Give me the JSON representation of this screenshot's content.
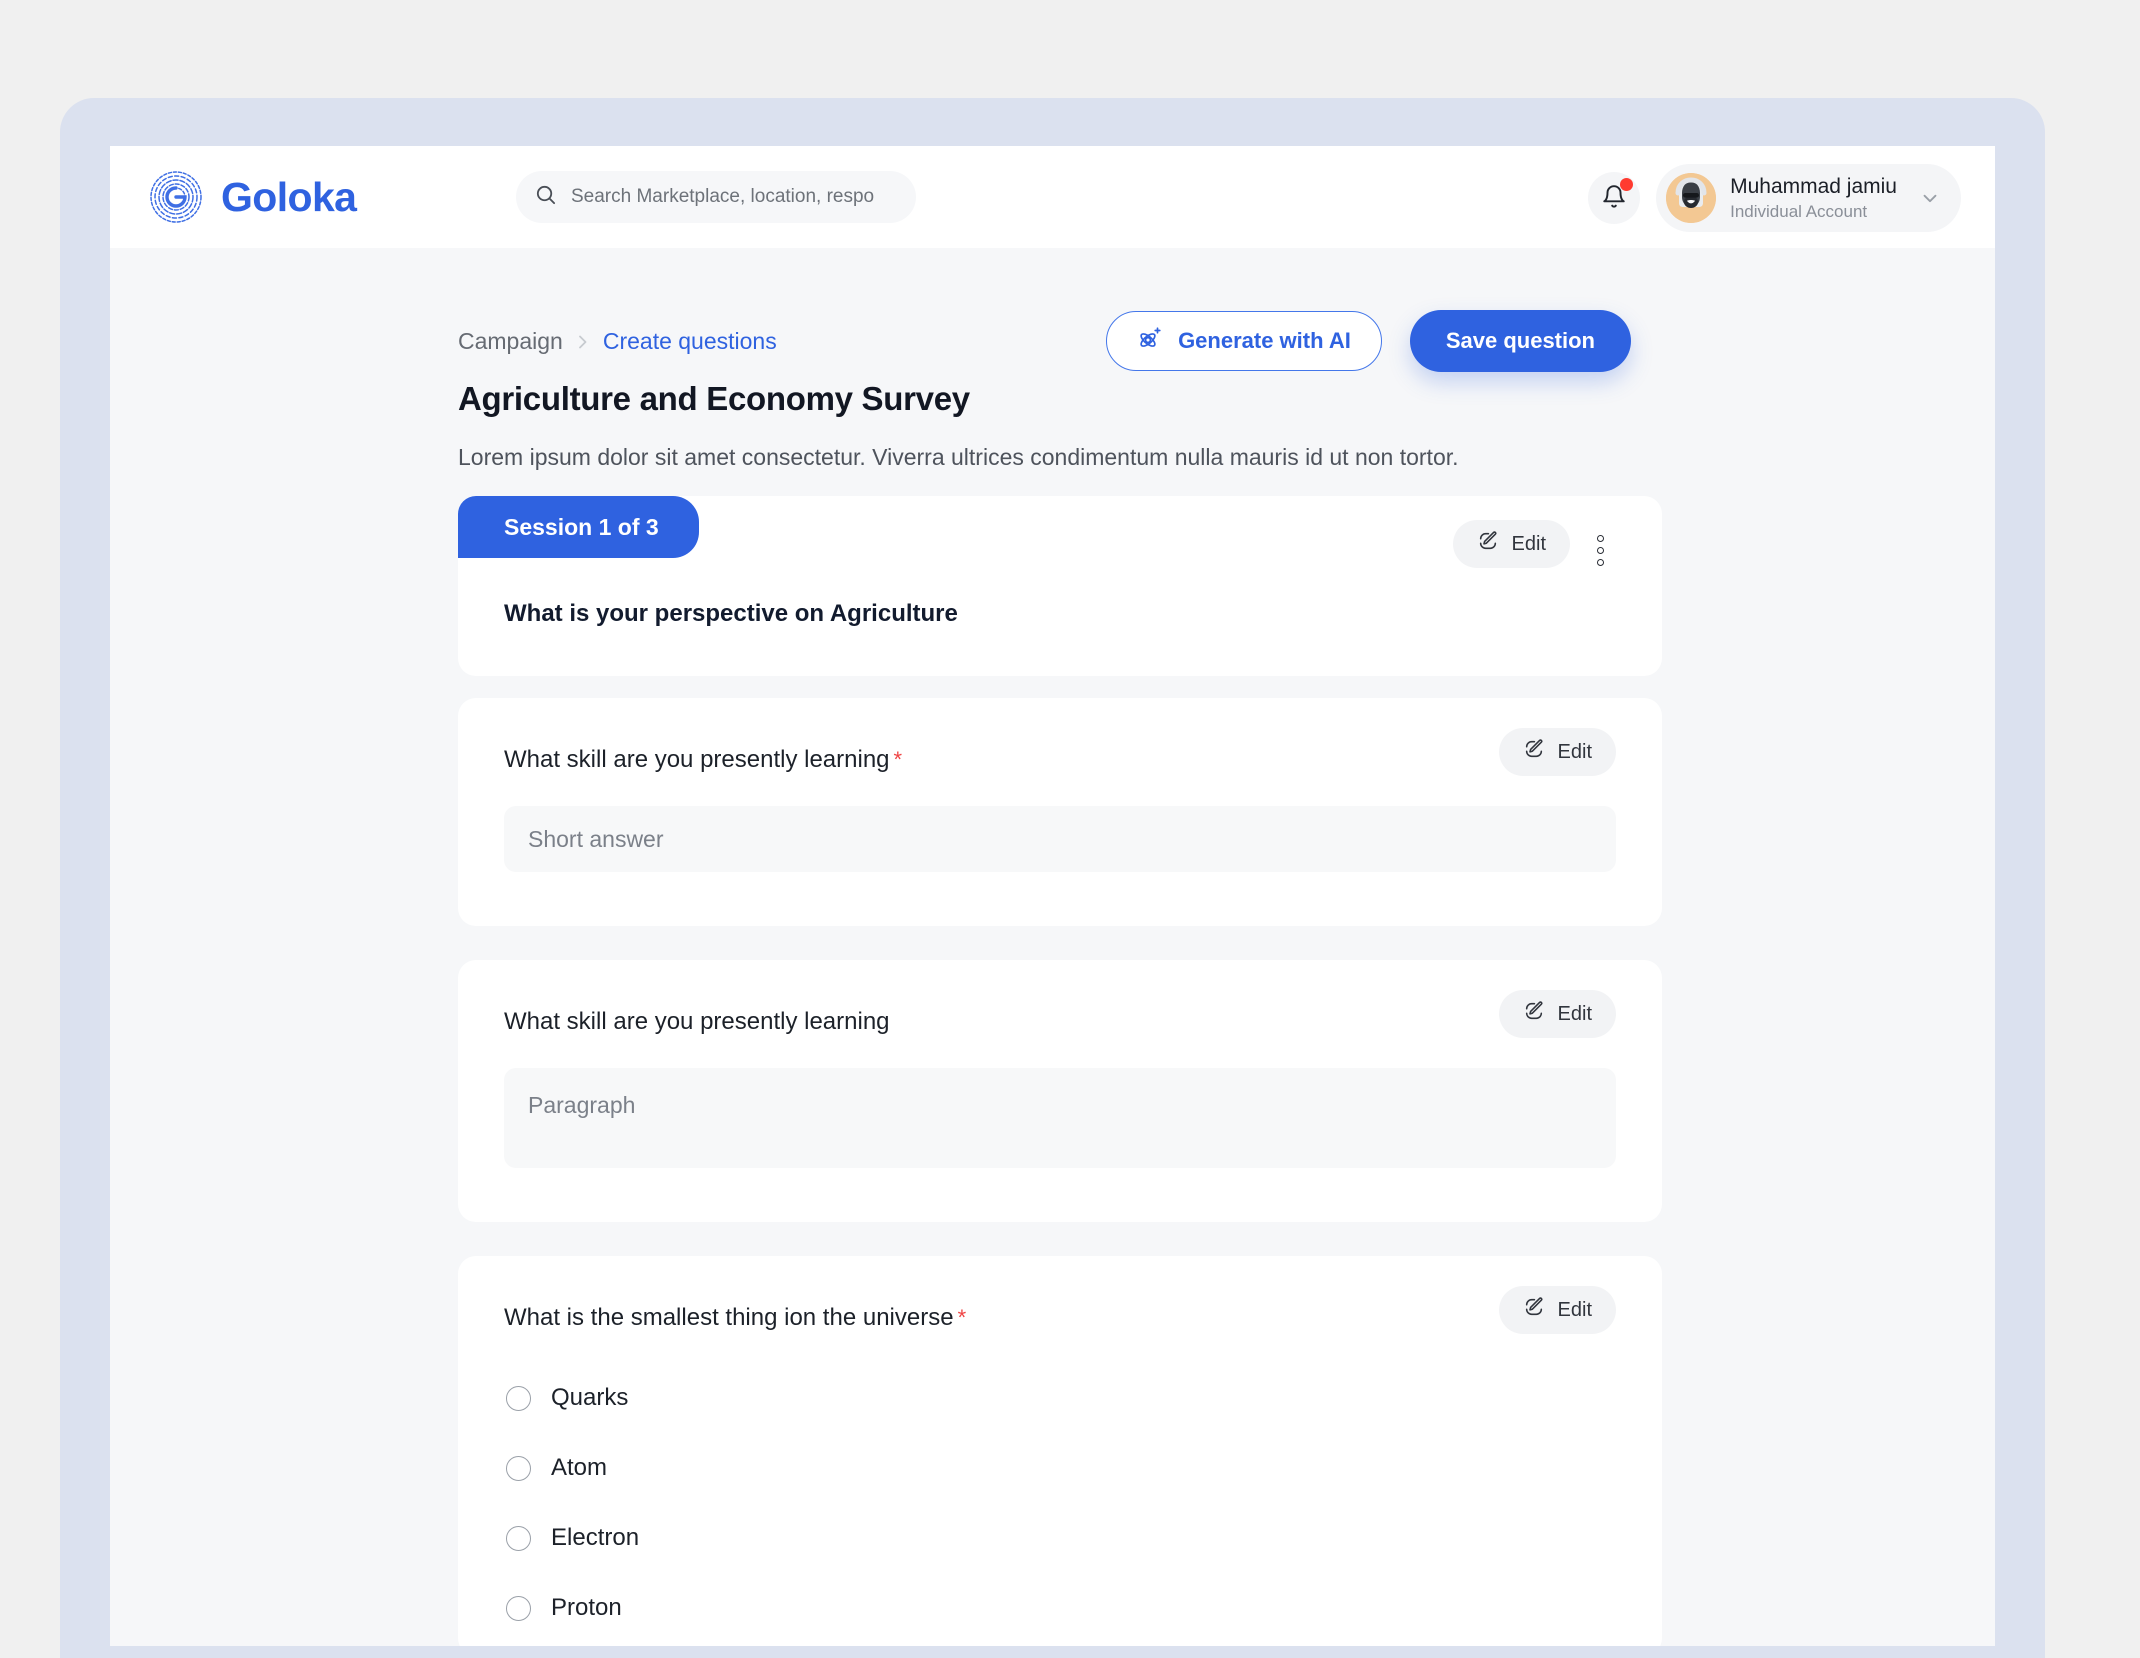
{
  "brand": {
    "name": "Goloka",
    "logo_icon": "fingerprint-logo-icon",
    "color": "#2f62e0"
  },
  "search": {
    "placeholder": "Search Marketplace, location, respo",
    "value": "",
    "icon": "search-icon"
  },
  "topbar": {
    "notifications": {
      "icon": "bell-icon",
      "has_unread": true,
      "dot_color": "#ff3b30"
    },
    "account": {
      "name": "Muhammad jamiu",
      "type": "Individual Account",
      "avatar_icon": "user-avatar",
      "chevron_icon": "chevron-down-icon"
    }
  },
  "breadcrumb": {
    "items": [
      {
        "label": "Campaign",
        "active": false
      },
      {
        "label": "Create questions",
        "active": true
      }
    ],
    "separator_icon": "chevron-right-icon"
  },
  "actions": {
    "generate_ai": {
      "label": "Generate with AI",
      "icon": "atom-sparkle-icon"
    },
    "save": {
      "label": "Save question"
    }
  },
  "page": {
    "title": "Agriculture and Economy Survey",
    "description": "Lorem ipsum dolor sit amet consectetur. Viverra ultrices condimentum nulla mauris id ut non tortor."
  },
  "session": {
    "tab_label": "Session 1 of 3",
    "question": "What is your perspective on Agriculture",
    "edit_label": "Edit",
    "edit_icon": "edit-pencil-icon",
    "menu_icon": "kebab-menu-icon"
  },
  "questions": [
    {
      "label": "What skill are you presently learning",
      "required": true,
      "required_marker": "*",
      "answer_type": "short",
      "placeholder": "Short answer",
      "edit_label": "Edit",
      "edit_icon": "edit-pencil-icon"
    },
    {
      "label": "What skill are you presently learning",
      "required": false,
      "required_marker": "",
      "answer_type": "paragraph",
      "placeholder": "Paragraph",
      "edit_label": "Edit",
      "edit_icon": "edit-pencil-icon"
    },
    {
      "label": "What is the smallest thing ion the universe",
      "required": true,
      "required_marker": "*",
      "answer_type": "radio",
      "edit_label": "Edit",
      "edit_icon": "edit-pencil-icon",
      "options": [
        {
          "label": "Quarks",
          "selected": false
        },
        {
          "label": "Atom",
          "selected": false
        },
        {
          "label": "Electron",
          "selected": false
        },
        {
          "label": "Proton",
          "selected": false
        }
      ]
    }
  ]
}
